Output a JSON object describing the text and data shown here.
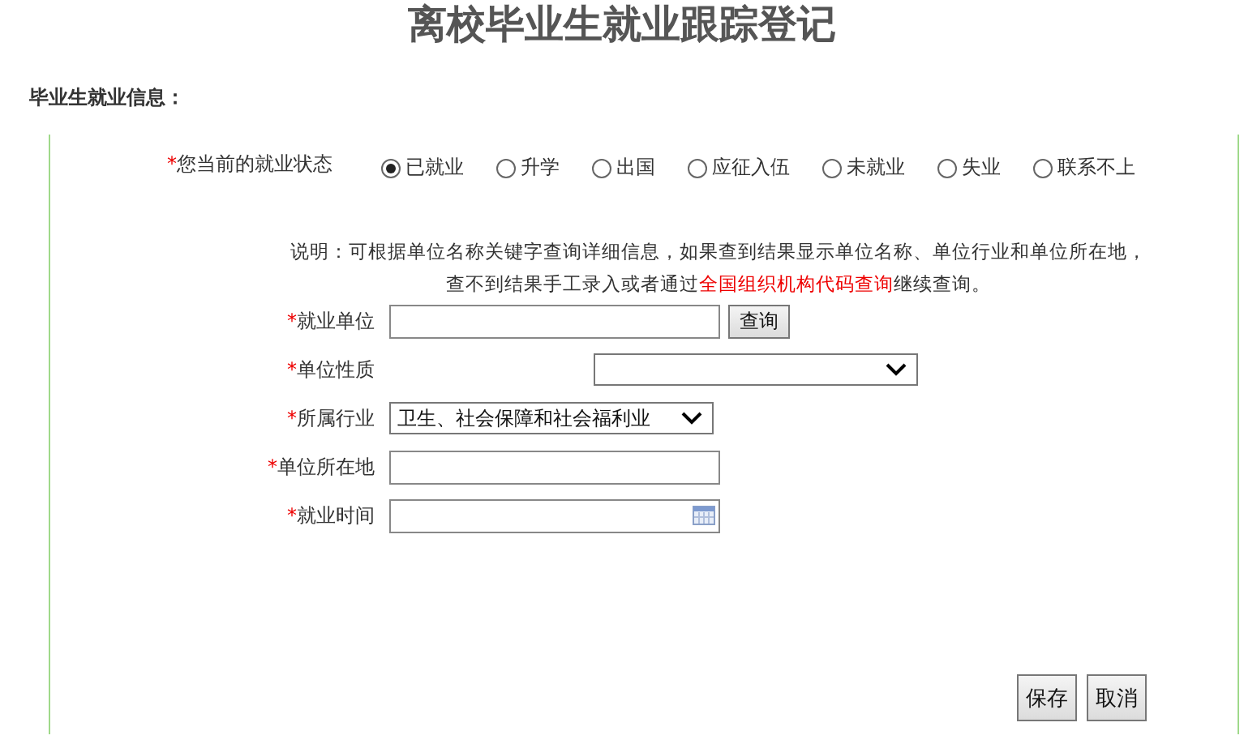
{
  "title": "离校毕业生就业跟踪登记",
  "section_heading": "毕业生就业信息：",
  "status": {
    "required_mark": "*",
    "label": "您当前的就业状态",
    "options": [
      {
        "label": "已就业",
        "selected": true
      },
      {
        "label": "升学",
        "selected": false
      },
      {
        "label": "出国",
        "selected": false
      },
      {
        "label": "应征入伍",
        "selected": false
      },
      {
        "label": "未就业",
        "selected": false
      },
      {
        "label": "失业",
        "selected": false
      },
      {
        "label": "联系不上",
        "selected": false
      }
    ]
  },
  "note": {
    "line_1": "说明：可根据单位名称关键字查询详细信息，如果查到结果显示单位名称、单位行业和单位所在地，",
    "line_2_before": "查不到结果手工录入或者通过",
    "link": "全国组织机构代码查询",
    "line_2_after": "继续查询。"
  },
  "fields": [
    {
      "kind": "text",
      "required_mark": "*",
      "label": "就业单位",
      "button": "查询"
    },
    {
      "kind": "select",
      "required_mark": "*",
      "label": "单位性质"
    },
    {
      "kind": "select",
      "required_mark": "*",
      "label": "所属行业",
      "value": "卫生、社会保障和社会福利业"
    },
    {
      "kind": "text",
      "required_mark": "*",
      "label": "单位所在地"
    },
    {
      "kind": "date",
      "required_mark": "*",
      "label": "就业时间"
    }
  ],
  "buttons": [
    "保存",
    "取消"
  ]
}
